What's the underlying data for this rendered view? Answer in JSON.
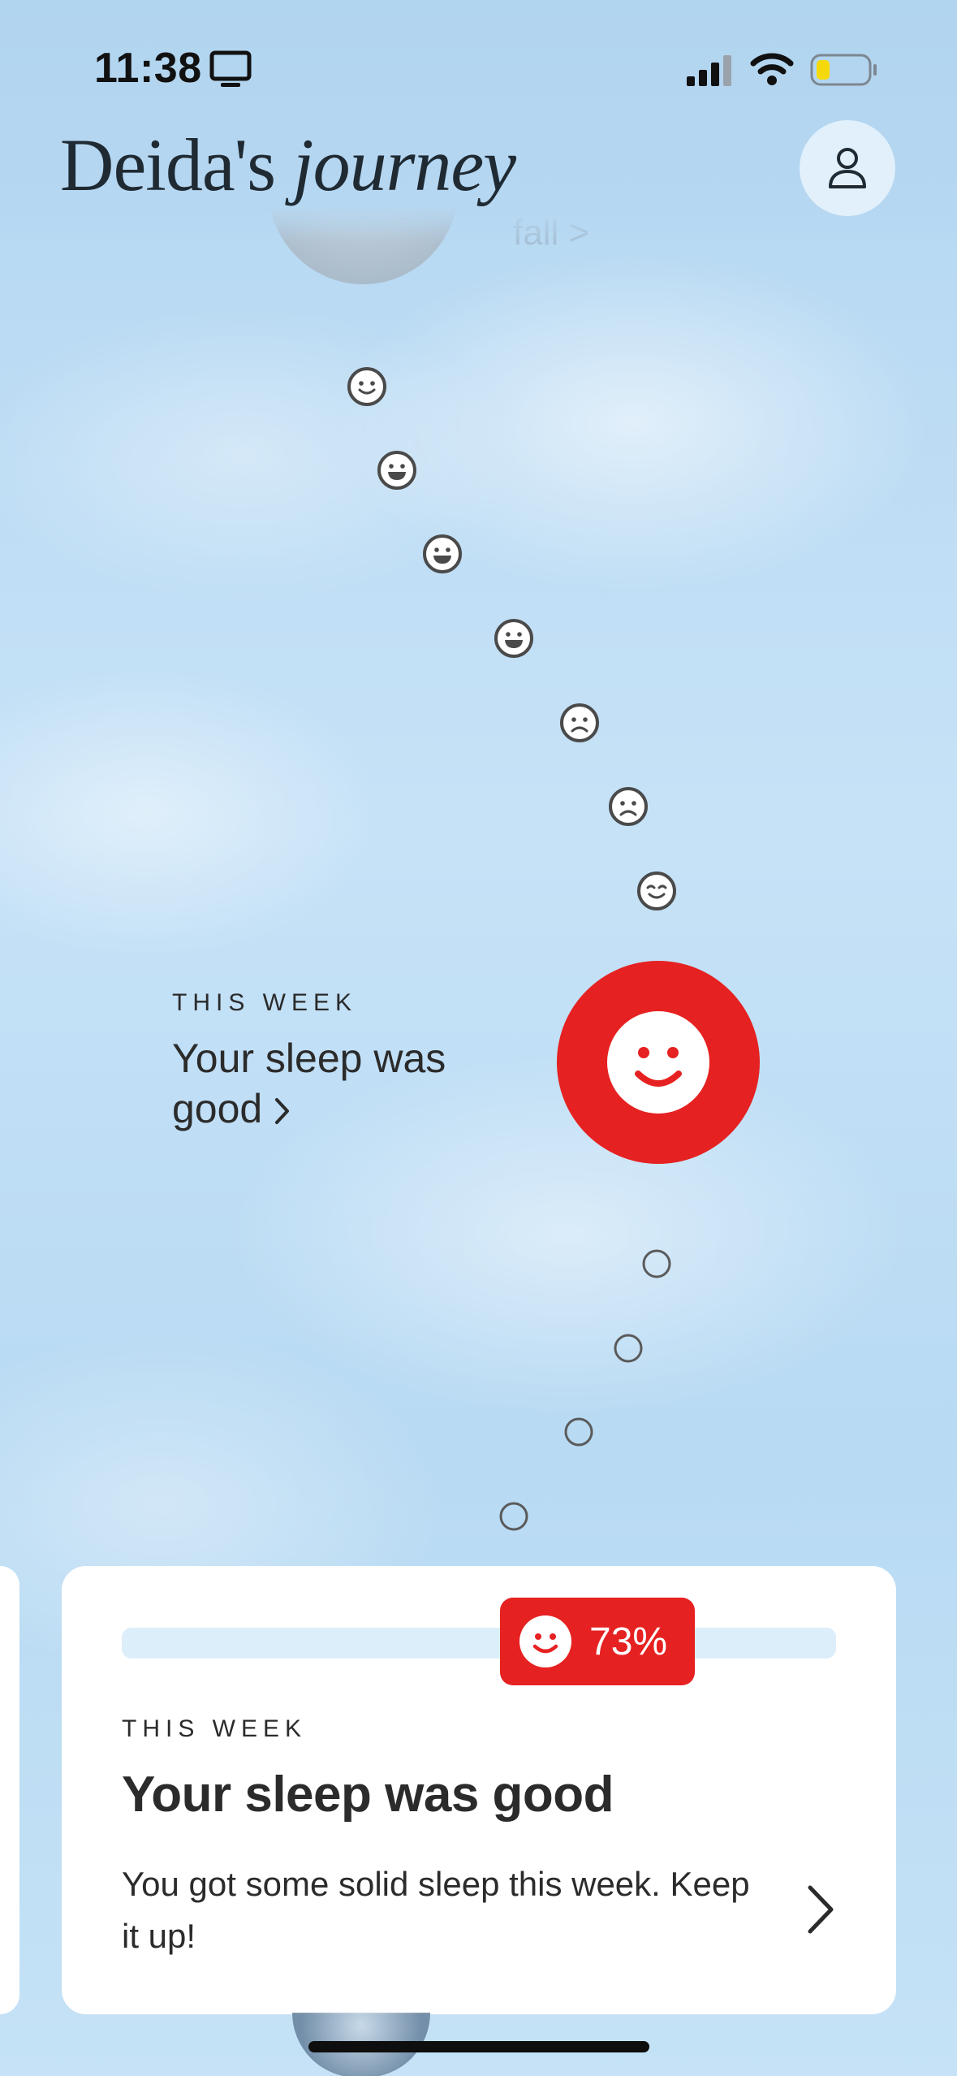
{
  "status_bar": {
    "time": "11:38"
  },
  "header": {
    "title_regular": "Deida's",
    "title_italic": "journey",
    "profile_icon": "person-icon"
  },
  "background_label": "fall >",
  "mood_trail": {
    "past_faces": [
      "smile",
      "grin",
      "grin",
      "grin",
      "frown",
      "frown",
      "content"
    ],
    "upcoming_empty_count": 4
  },
  "this_week": {
    "overline": "THIS WEEK",
    "title": "Your sleep was good",
    "chevron": ">",
    "face": "smile-icon",
    "accent_color": "#e62121"
  },
  "card": {
    "progress_percent_label": "73%",
    "progress_value": 0.73,
    "overline": "THIS WEEK",
    "title": "Your sleep was good",
    "body": "You got some solid sleep this week. Keep it up!",
    "chevron_icon": "chevron-right-icon"
  }
}
